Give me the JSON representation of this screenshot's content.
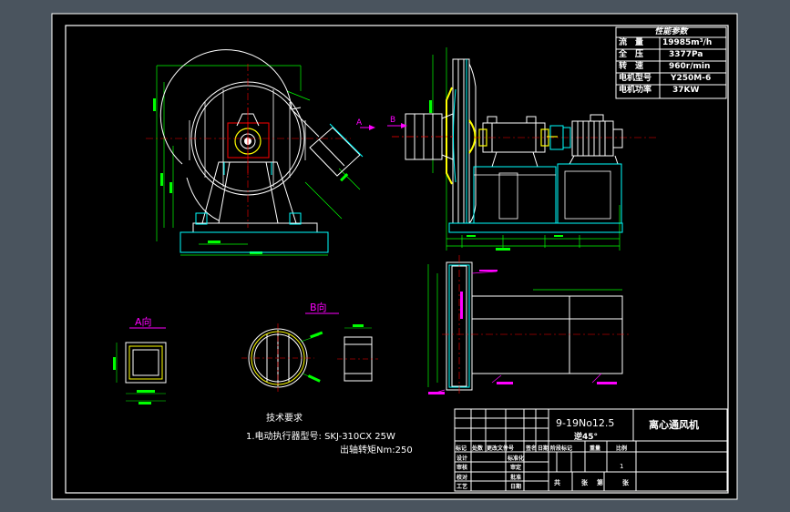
{
  "params_table": {
    "title": "性能参数",
    "rows": [
      {
        "label": "流　量",
        "value": "19985m³/h"
      },
      {
        "label": "全　压",
        "value": "3377Pa"
      },
      {
        "label": "转　速",
        "value": "960r/min"
      },
      {
        "label": "电机型号",
        "value": "Y250M-6"
      },
      {
        "label": "电机功率",
        "value": "37KW"
      }
    ]
  },
  "views": {
    "a_view_label": "A向",
    "b_view_label": "B向",
    "arrow_a": "A",
    "arrow_b": "B"
  },
  "notes": {
    "heading": "技术要求",
    "line1": "1.电动执行器型号: SKJ-310CX  25W",
    "line2": "出轴转矩Nm:250"
  },
  "title_block": {
    "model": "9-19No12.5",
    "rotation": "逆45°",
    "name": "离心通风机",
    "header_cells": [
      "标记",
      "处数",
      "更改文件号",
      "签名",
      "日期"
    ],
    "role_rows": [
      {
        "role": "设计",
        "mid": "标准化"
      },
      {
        "role": "审核",
        "mid": "审定"
      },
      {
        "role": "校对",
        "mid": "批准"
      },
      {
        "role": "工艺",
        "mid": "日期"
      }
    ],
    "stage_header": [
      "阶段标记",
      "重量",
      "比例"
    ],
    "scale": "1",
    "sheet_cells": [
      "共",
      "张",
      "第",
      "张"
    ]
  },
  "colors": {
    "background": "#4a545e",
    "sheet": "#000000",
    "outline": "#ffffff",
    "housing": "#00ffff",
    "dimension": "#00ff00",
    "flange": "#ffff00",
    "center": "#ff0000",
    "label": "#ff00ff"
  }
}
